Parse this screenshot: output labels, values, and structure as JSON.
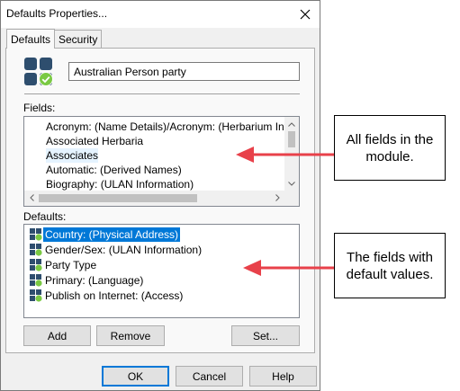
{
  "window": {
    "title": "Defaults Properties..."
  },
  "tabs": [
    {
      "label": "Defaults",
      "active": true
    },
    {
      "label": "Security",
      "active": false
    }
  ],
  "record": {
    "name_value": "Australian Person party"
  },
  "fields": {
    "label": "Fields:",
    "items": [
      "Acronym: (Name Details)/Acronym: (Herbarium Informa",
      "Associated Herbaria",
      "Associates",
      "Automatic: (Derived Names)",
      "Biography: (ULAN Information)"
    ],
    "selected_index": 2
  },
  "defaults": {
    "label": "Defaults:",
    "items": [
      "Country: (Physical Address)",
      "Gender/Sex: (ULAN Information)",
      "Party Type",
      "Primary: (Language)",
      "Publish on Internet: (Access)"
    ],
    "selected_index": 0
  },
  "buttons": {
    "add": "Add",
    "remove": "Remove",
    "set": "Set...",
    "ok": "OK",
    "cancel": "Cancel",
    "help": "Help"
  },
  "annotations": {
    "fields_note": "All fields in the\nmodule.",
    "defaults_note": "The fields with\ndefault values."
  },
  "colors": {
    "accent": "#0078d7",
    "icon_tile": "#2e4e6e",
    "check_badge": "#7ac943",
    "arrow": "#e8414a"
  },
  "icons": {
    "close": "close-icon",
    "app": "defaults-grid-icon",
    "row": "default-field-icon"
  }
}
